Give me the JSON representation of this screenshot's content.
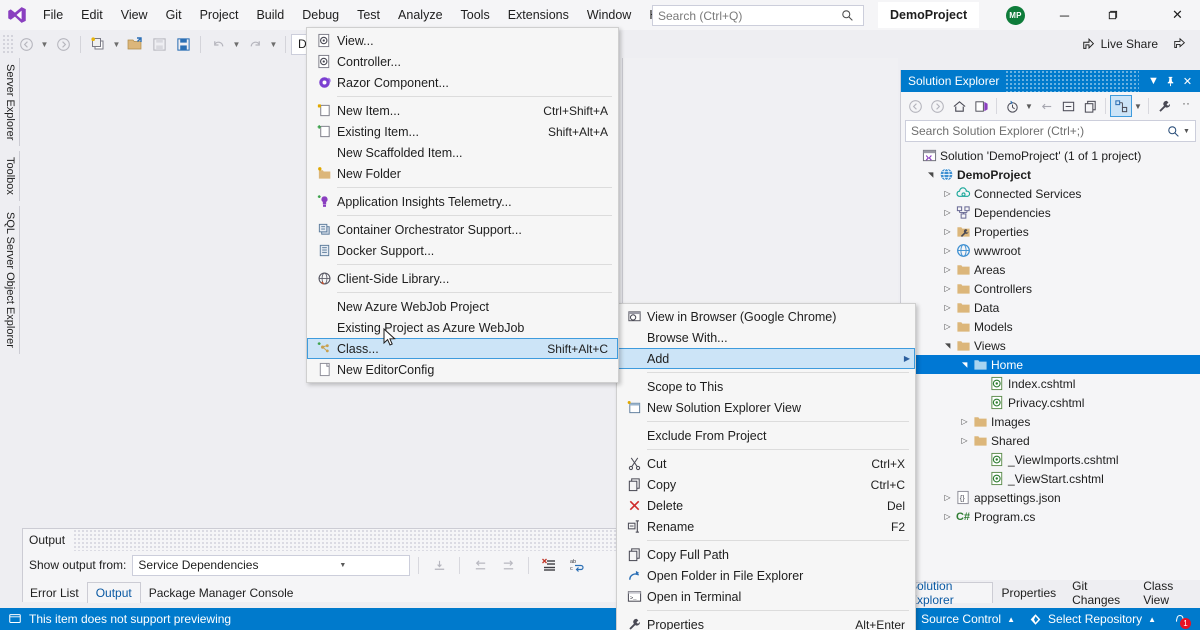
{
  "titlebar": {
    "logo_icon": "visual-studio-logo",
    "menus": [
      "File",
      "Edit",
      "View",
      "Git",
      "Project",
      "Build",
      "Debug",
      "Test",
      "Analyze",
      "Tools",
      "Extensions",
      "Window",
      "Help"
    ],
    "search_placeholder": "Search (Ctrl+Q)",
    "search_value": "",
    "search_icon": "search-icon",
    "project_chip": "DemoProject",
    "avatar_initials": "MP",
    "avatar_color": "#0e7c3a",
    "minimize": "─",
    "maximize": "❐",
    "close": "✕"
  },
  "toolbar": {
    "back_icon": "navigate-back-icon",
    "forward_icon": "navigate-forward-icon",
    "new_project_icon": "new-project-icon",
    "open_file_icon": "open-file-icon",
    "save_icon": "save-icon",
    "save_all_icon": "save-all-icon",
    "undo_icon": "undo-icon",
    "redo_icon": "redo-icon",
    "config_value": "Debug",
    "find_in_files_icon": "find-in-files-icon",
    "window_layout_icon": "window-layout-icon",
    "live_share_label": "Live Share",
    "live_share_icon": "live-share-icon",
    "feedback_icon": "send-feedback-icon"
  },
  "vertical_tabs": [
    {
      "label": "Server Explorer",
      "name": "vtab-server-explorer"
    },
    {
      "label": "Toolbox",
      "name": "vtab-toolbox"
    },
    {
      "label": "SQL Server Object Explorer",
      "name": "vtab-sql-server-object-explorer"
    }
  ],
  "add_menu": {
    "items": [
      {
        "label": "View...",
        "icon": "razor-view-icon",
        "shortcut": "",
        "sep_after": false
      },
      {
        "label": "Controller...",
        "icon": "controller-icon",
        "shortcut": "",
        "sep_after": false
      },
      {
        "label": "Razor Component...",
        "icon": "razor-component-icon",
        "shortcut": "",
        "sep_after": true
      },
      {
        "label": "New Item...",
        "icon": "new-item-icon",
        "shortcut": "Ctrl+Shift+A",
        "sep_after": false
      },
      {
        "label": "Existing Item...",
        "icon": "existing-item-icon",
        "shortcut": "Shift+Alt+A",
        "sep_after": false
      },
      {
        "label": "New Scaffolded Item...",
        "icon": "",
        "shortcut": "",
        "sep_after": false
      },
      {
        "label": "New Folder",
        "icon": "new-folder-icon",
        "shortcut": "",
        "sep_after": true
      },
      {
        "label": "Application Insights Telemetry...",
        "icon": "app-insights-icon",
        "shortcut": "",
        "sep_after": true
      },
      {
        "label": "Container Orchestrator Support...",
        "icon": "container-orchestrator-icon",
        "shortcut": "",
        "sep_after": false
      },
      {
        "label": "Docker Support...",
        "icon": "docker-icon",
        "shortcut": "",
        "sep_after": true
      },
      {
        "label": "Client-Side Library...",
        "icon": "client-side-library-icon",
        "shortcut": "",
        "sep_after": true
      },
      {
        "label": "New Azure WebJob Project",
        "icon": "",
        "shortcut": "",
        "sep_after": false
      },
      {
        "label": "Existing Project as Azure WebJob",
        "icon": "",
        "shortcut": "",
        "sep_after": false
      },
      {
        "label": "Class...",
        "icon": "class-icon",
        "shortcut": "Shift+Alt+C",
        "sep_after": false,
        "highlighted": true
      },
      {
        "label": "New EditorConfig",
        "icon": "editorconfig-icon",
        "shortcut": "",
        "sep_after": false
      }
    ]
  },
  "context_menu": {
    "items": [
      {
        "label": "View in Browser (Google Chrome)",
        "icon": "view-in-browser-icon",
        "shortcut": "",
        "sep_after": false
      },
      {
        "label": "Browse With...",
        "icon": "",
        "shortcut": "",
        "sep_after": false
      },
      {
        "label": "Add",
        "icon": "",
        "shortcut": "",
        "submenu": true,
        "highlighted": true,
        "sep_after": true
      },
      {
        "label": "Scope to This",
        "icon": "",
        "shortcut": "",
        "sep_after": false
      },
      {
        "label": "New Solution Explorer View",
        "icon": "new-solution-explorer-view-icon",
        "shortcut": "",
        "sep_after": true
      },
      {
        "label": "Exclude From Project",
        "icon": "",
        "shortcut": "",
        "sep_after": true
      },
      {
        "label": "Cut",
        "icon": "cut-icon",
        "shortcut": "Ctrl+X",
        "sep_after": false
      },
      {
        "label": "Copy",
        "icon": "copy-icon",
        "shortcut": "Ctrl+C",
        "sep_after": false
      },
      {
        "label": "Delete",
        "icon": "delete-icon",
        "shortcut": "Del",
        "sep_after": false
      },
      {
        "label": "Rename",
        "icon": "rename-icon",
        "shortcut": "F2",
        "sep_after": true
      },
      {
        "label": "Copy Full Path",
        "icon": "copy-full-path-icon",
        "shortcut": "",
        "sep_after": false
      },
      {
        "label": "Open Folder in File Explorer",
        "icon": "open-folder-icon",
        "shortcut": "",
        "sep_after": false
      },
      {
        "label": "Open in Terminal",
        "icon": "terminal-icon",
        "shortcut": "",
        "sep_after": true
      },
      {
        "label": "Properties",
        "icon": "properties-icon",
        "shortcut": "Alt+Enter",
        "sep_after": false
      }
    ]
  },
  "solution_explorer": {
    "title": "Solution Explorer",
    "dropdown_icon": "chevron-down-icon",
    "pin_icon": "pin-icon",
    "close_icon": "close-icon",
    "toolbar_icons": [
      "navigate-back-icon",
      "navigate-forward-icon",
      "home-icon",
      "pending-changes-icon",
      "sync-with-active-document-icon",
      "refresh-icon",
      "collapse-all-icon",
      "show-all-files-icon",
      "view-switch-icon",
      "properties-wrench-icon",
      "overflow-icon"
    ],
    "search_placeholder": "Search Solution Explorer (Ctrl+;)",
    "search_value": "",
    "search_icon": "search-icon",
    "tree": [
      {
        "label": "Solution 'DemoProject' (1 of 1 project)",
        "icon": "solution-icon",
        "depth": 0,
        "twisty": "none",
        "bold": false
      },
      {
        "label": "DemoProject",
        "icon": "web-project-icon",
        "depth": 1,
        "twisty": "expanded",
        "bold": true
      },
      {
        "label": "Connected Services",
        "icon": "connected-services-icon",
        "depth": 2,
        "twisty": "collapsed",
        "bold": false
      },
      {
        "label": "Dependencies",
        "icon": "dependencies-icon",
        "depth": 2,
        "twisty": "collapsed",
        "bold": false
      },
      {
        "label": "Properties",
        "icon": "properties-folder-icon",
        "depth": 2,
        "twisty": "collapsed",
        "bold": false
      },
      {
        "label": "wwwroot",
        "icon": "wwwroot-icon",
        "depth": 2,
        "twisty": "collapsed",
        "bold": false
      },
      {
        "label": "Areas",
        "icon": "folder-icon",
        "depth": 2,
        "twisty": "collapsed",
        "bold": false
      },
      {
        "label": "Controllers",
        "icon": "folder-icon",
        "depth": 2,
        "twisty": "collapsed",
        "bold": false
      },
      {
        "label": "Data",
        "icon": "folder-icon",
        "depth": 2,
        "twisty": "collapsed",
        "bold": false
      },
      {
        "label": "Models",
        "icon": "folder-icon",
        "depth": 2,
        "twisty": "collapsed",
        "bold": false
      },
      {
        "label": "Views",
        "icon": "folder-icon",
        "depth": 2,
        "twisty": "expanded",
        "bold": false
      },
      {
        "label": "Home",
        "icon": "folder-open-icon",
        "depth": 3,
        "twisty": "expanded",
        "bold": false,
        "selected": true
      },
      {
        "label": "Index.cshtml",
        "icon": "cshtml-icon",
        "depth": 4,
        "twisty": "none",
        "bold": false
      },
      {
        "label": "Privacy.cshtml",
        "icon": "cshtml-icon",
        "depth": 4,
        "twisty": "none",
        "bold": false
      },
      {
        "label": "Images",
        "icon": "folder-icon",
        "depth": 3,
        "twisty": "collapsed",
        "bold": false
      },
      {
        "label": "Shared",
        "icon": "folder-icon",
        "depth": 3,
        "twisty": "collapsed",
        "bold": false
      },
      {
        "label": "_ViewImports.cshtml",
        "icon": "cshtml-icon",
        "depth": 4,
        "twisty": "none",
        "bold": false
      },
      {
        "label": "_ViewStart.cshtml",
        "icon": "cshtml-icon",
        "depth": 4,
        "twisty": "none",
        "bold": false
      },
      {
        "label": "appsettings.json",
        "icon": "json-icon",
        "depth": 2,
        "twisty": "collapsed",
        "bold": false
      },
      {
        "label": "Program.cs",
        "icon": "csharp-icon",
        "depth": 2,
        "twisty": "collapsed",
        "bold": false
      }
    ]
  },
  "output_panel": {
    "title": "Output",
    "show_output_from_label": "Show output from:",
    "source_value": "Service Dependencies",
    "dropdown_icon": "chevron-down-icon",
    "buttons": [
      "find-message-icon",
      "go-to-previous-icon",
      "go-to-next-icon",
      "clear-all-icon",
      "toggle-word-wrap-icon"
    ]
  },
  "bottom_tabs_left": [
    {
      "label": "Error List",
      "active": false
    },
    {
      "label": "Output",
      "active": true
    },
    {
      "label": "Package Manager Console",
      "active": false
    }
  ],
  "bottom_tabs_right": [
    {
      "label": "Solution Explorer",
      "active": true
    },
    {
      "label": "Properties",
      "active": false
    },
    {
      "label": "Git Changes",
      "active": false
    },
    {
      "label": "Class View",
      "active": false
    }
  ],
  "statusbar": {
    "message": "This item does not support previewing",
    "message_icon": "preview-icon",
    "source_control_label": "Source Control",
    "source_control_icon": "caret-up-icon",
    "select_repository_label": "Select Repository",
    "select_repository_icon": "repository-icon",
    "notification_icon": "bell-icon",
    "notification_count": "1"
  },
  "colors": {
    "accent_blue": "#007acc",
    "selection_blue": "#0078d4",
    "menu_highlight": "#cce4f7",
    "titlebar_bg": "#f5f5f7",
    "chrome_bg": "#eeeef2",
    "badge_red": "#e81123"
  }
}
